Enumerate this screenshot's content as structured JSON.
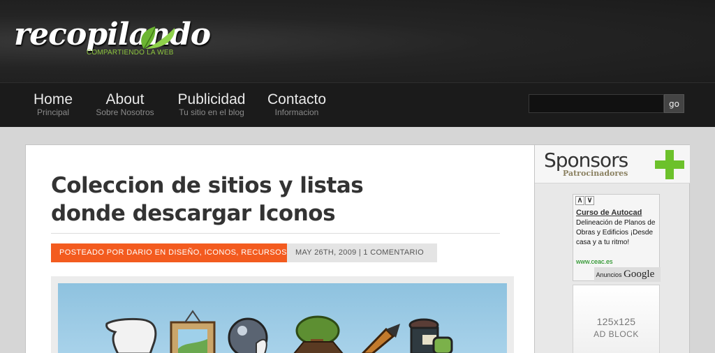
{
  "logo": {
    "name": "recopilando",
    "tagline": "COMPARTIENDO LA WEB"
  },
  "nav": [
    {
      "title": "Home",
      "subtitle": "Principal"
    },
    {
      "title": "About",
      "subtitle": "Sobre Nosotros"
    },
    {
      "title": "Publicidad",
      "subtitle": "Tu sitio en el blog"
    },
    {
      "title": "Contacto",
      "subtitle": "Informacion"
    }
  ],
  "search": {
    "value": "",
    "button": "go"
  },
  "post": {
    "title": "Coleccion de sitios y listas donde descargar Iconos",
    "byline": "POSTEADO POR DARIO EN DISEÑO, ICONOS, RECURSOS",
    "date_comments": "MAY 26TH, 2009 | 1 COMENTARIO"
  },
  "sidebar": {
    "title": "Sponsors",
    "subtitle": "Patrocinadores",
    "ad": {
      "nav_left": "∧",
      "nav_right": "∨",
      "link": "Curso de Autocad",
      "text": "Delineación de Planos de Obras y Edificios ¡Desde casa y a tu ritmo!",
      "url": "www.ceac.es",
      "footer_prefix": "Anuncios",
      "footer_brand": "Google"
    },
    "ad_block": {
      "size": "125x125",
      "label": "AD BLOCK"
    }
  },
  "colors": {
    "accent": "#f35b1f",
    "green": "#6cc12b",
    "header_bg": "#1b1b1b"
  }
}
